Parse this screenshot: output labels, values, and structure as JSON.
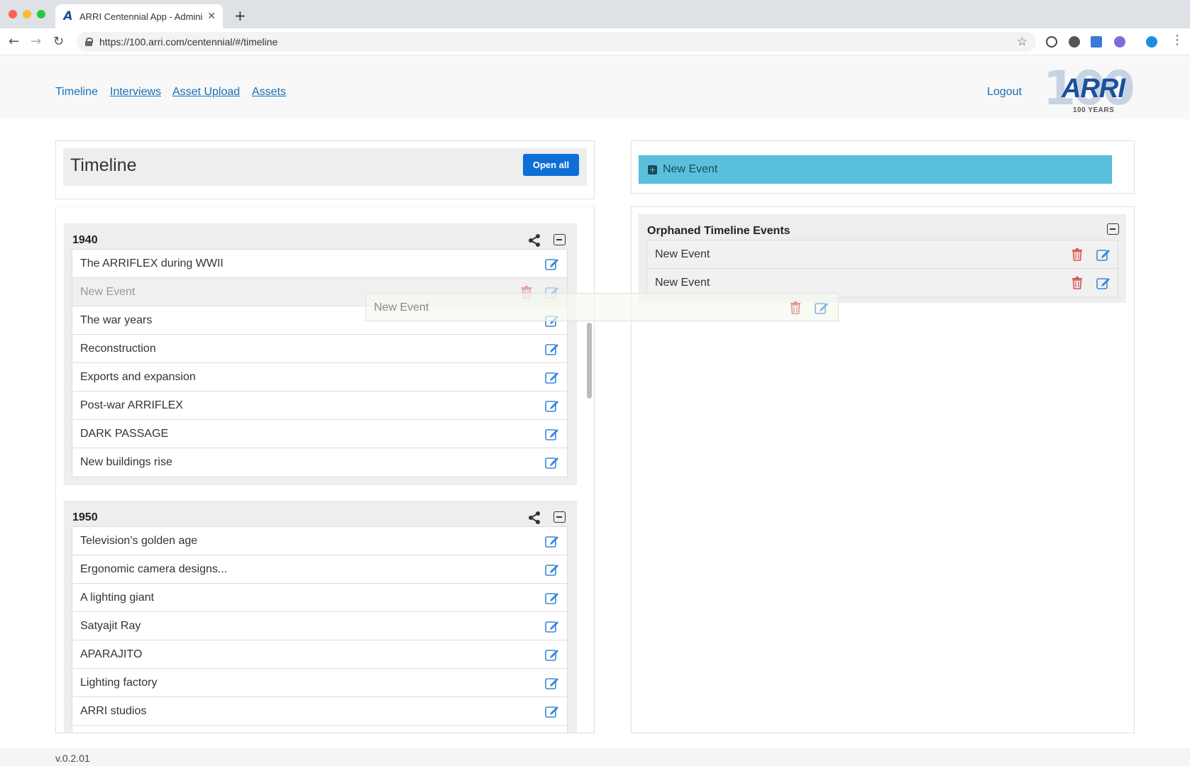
{
  "browser": {
    "tab_title": "ARRI Centennial App - Adminis",
    "tab_favicon": "A",
    "url": "https://100.arri.com/centennial/#/timeline"
  },
  "nav": {
    "links": [
      "Timeline",
      "Interviews",
      "Asset Upload",
      "Assets"
    ],
    "logout": "Logout"
  },
  "logo": {
    "numeral": "100",
    "brand": "ARRI",
    "tagline": "100 YEARS"
  },
  "timeline": {
    "title": "Timeline",
    "open_all_label": "Open all",
    "decades": [
      {
        "label": "1940",
        "events": [
          "The ARRIFLEX during WWII",
          "New Event",
          "The war years",
          "Reconstruction",
          "Exports and expansion",
          "Post-war ARRIFLEX",
          "DARK PASSAGE",
          "New buildings rise"
        ]
      },
      {
        "label": "1950",
        "events": [
          "Television’s golden age",
          "Ergonomic camera designs...",
          "A lighting giant",
          "Satyajit Ray",
          "APARAJITO",
          "Lighting factory",
          "ARRI studios"
        ]
      }
    ]
  },
  "orphaned": {
    "new_event_label": "New Event",
    "title": "Orphaned Timeline Events",
    "events": [
      "New Event",
      "New Event"
    ]
  },
  "drag_ghost": {
    "label": "New Event"
  },
  "footer": {
    "version": "v.0.2.01"
  },
  "colors": {
    "link": "#1a6fb5",
    "primary": "#0d6fd6",
    "info": "#5bc0de",
    "danger": "#d9534f",
    "edit": "#3a87d6"
  }
}
